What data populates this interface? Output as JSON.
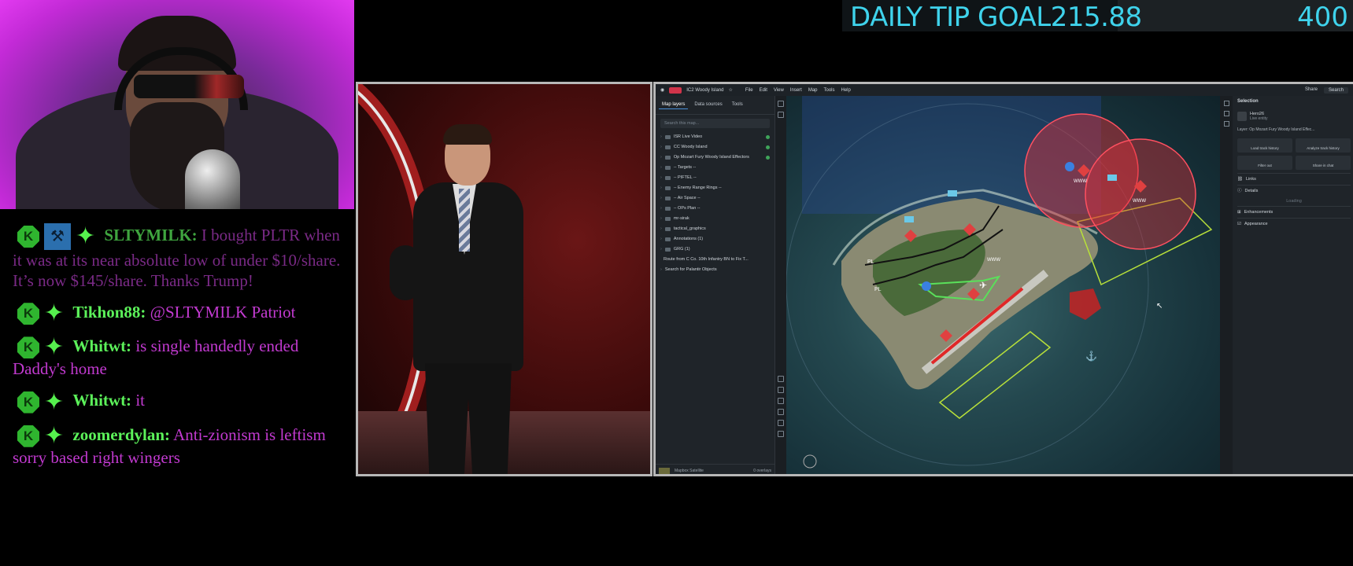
{
  "tip_goal": {
    "label": "DAILY TIP GOAL",
    "current": "215.88",
    "target": "400",
    "progress_fraction": 0.54
  },
  "chat": {
    "messages": [
      {
        "user": "SLTYMILK:",
        "text": "I bought PLTR when it was at its near absolute low of under $10/share. It’s now $145/share. Thanks Trump!",
        "badges": [
          "k-icon",
          "hammer-icon",
          "star-icon"
        ],
        "faded": true
      },
      {
        "user": "Tikhon88:",
        "text": "@SLTYMILK Patriot",
        "badges": [
          "k-icon",
          "star-icon"
        ],
        "faded": false
      },
      {
        "user": "Whitwt:",
        "text": "is single handedly ended Daddy's home",
        "badges": [
          "k-icon",
          "star-icon"
        ],
        "faded": false
      },
      {
        "user": "Whitwt:",
        "text": "it",
        "badges": [
          "k-icon",
          "star-icon"
        ],
        "faded": false
      },
      {
        "user": "zoomerdylan:",
        "text": "Anti-zionism is leftism sorry based right wingers",
        "badges": [
          "k-icon",
          "star-icon"
        ],
        "faded": false
      }
    ]
  },
  "app": {
    "doc_title": "IC2 Woody Island",
    "menu": [
      "File",
      "Edit",
      "View",
      "Insert",
      "Map",
      "Tools",
      "Help"
    ],
    "share": "Share",
    "search": "Search",
    "tabs": [
      "Map layers",
      "Data sources",
      "Tools"
    ],
    "search_placeholder": "Search this map...",
    "layers": [
      "ISR Live Video",
      "CC Woody Island",
      "Op Mozart Fury Woody Island Effectors",
      "-- Targets --",
      "-- PIFTEL --",
      "-- Enemy Range Rings --",
      "-- Air Space --",
      "-- OPs Plan --",
      "mr-sirak",
      "tactical_graphics",
      "Annotations (1)",
      "GRG (1)",
      "Route from C Co. 10th Infantry BN to Fix T...",
      "Search for Palantir Objects"
    ],
    "basemap": "Mapbox Satellite",
    "overlays": "0 overlays",
    "selection": {
      "title": "Selection",
      "entity": "Hero26",
      "entity_sub": "Live entity",
      "layer": "Layer: Op Mozart Fury Woody Island Effec...",
      "buttons": [
        "Load track history",
        "Analyze track history",
        "Filter out",
        "Share in chat"
      ],
      "loading": "Loading",
      "sections": [
        "Links",
        "Details",
        "Enhancements",
        "Appearance"
      ]
    }
  },
  "map_markers": [
    "PL",
    "PL",
    "WWW",
    "WWW",
    "WWW"
  ],
  "colors": {
    "tip_text": "#3fd3ec",
    "chat_text": "#c23ad0",
    "chat_user": "#5cf25a",
    "range_ring": "#e0303a",
    "zone_outline": "#b8e03a"
  }
}
